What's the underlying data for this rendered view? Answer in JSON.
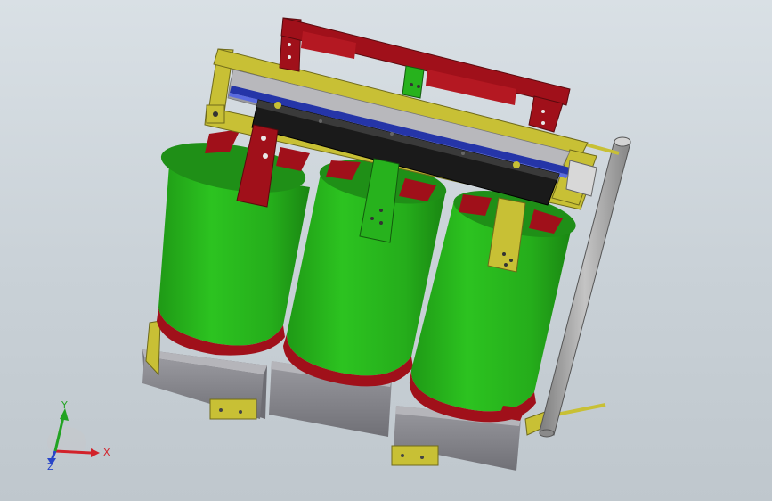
{
  "viewport": {
    "background": "#c9d1d7",
    "model": "dry-type-three-phase-transformer-assembly"
  },
  "colors": {
    "coil_green": "#27b21d",
    "clamp_yellow": "#c8c035",
    "busbar_red": "#a0101a",
    "insulator_red": "#b41822",
    "base_gray": "#8a8a90",
    "rail_blue": "#2535a8",
    "rod_gray": "#a6a6a6"
  },
  "triad": {
    "x_label": "X",
    "y_label": "Y",
    "z_label": "Z",
    "x_color": "#d2222a",
    "y_color": "#22a322",
    "z_color": "#2845c8"
  }
}
